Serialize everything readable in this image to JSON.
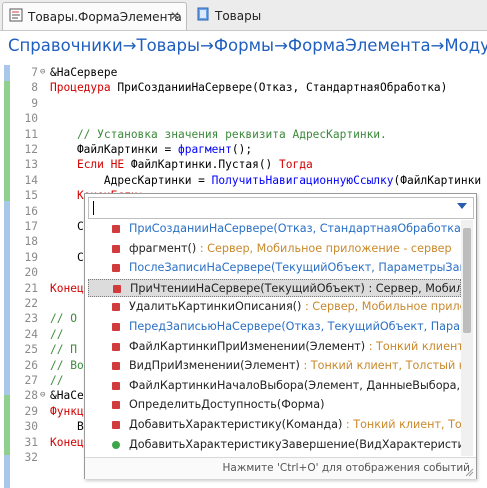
{
  "tabs": [
    {
      "label": "Товары.ФормаЭлемента",
      "close": "✕"
    },
    {
      "label": "Товары"
    }
  ],
  "breadcrumb": "Справочники→Товары→Формы→ФормаЭлемента→Модуль",
  "lines": [
    {
      "num": "7",
      "fold": "⊖",
      "parts": [
        {
          "t": "&НаСервере",
          "c": "pl"
        }
      ]
    },
    {
      "num": "8",
      "parts": [
        {
          "t": "Процедура",
          "c": "kw"
        },
        {
          "t": " ПриСозданииНаСервере(Отказ, СтандартнаяОбработка)",
          "c": "pl"
        }
      ]
    },
    {
      "num": "9",
      "parts": []
    },
    {
      "num": "10",
      "parts": []
    },
    {
      "num": "11",
      "parts": [
        {
          "t": "    // Установка значения реквизита АдресКартинки.",
          "c": "cm"
        }
      ]
    },
    {
      "num": "12",
      "parts": [
        {
          "t": "    ФайлКартинки = ",
          "c": "pl"
        },
        {
          "t": "фрагмент",
          "c": "fn"
        },
        {
          "t": "();",
          "c": "pl"
        }
      ]
    },
    {
      "num": "13",
      "parts": [
        {
          "t": "    ",
          "c": "pl"
        },
        {
          "t": "Если НЕ",
          "c": "kw"
        },
        {
          "t": " ФайлКартинки.Пустая() ",
          "c": "pl"
        },
        {
          "t": "Тогда",
          "c": "kw"
        }
      ]
    },
    {
      "num": "14",
      "parts": [
        {
          "t": "        АдресКартинки = ",
          "c": "pl"
        },
        {
          "t": "ПолучитьНавигационнуюСсылку",
          "c": "fn"
        },
        {
          "t": "(ФайлКартинки",
          "c": "pl"
        }
      ]
    },
    {
      "num": "15",
      "parts": [
        {
          "t": "    КонецЕсли;",
          "c": "kw"
        }
      ]
    },
    {
      "num": "16",
      "parts": []
    },
    {
      "num": "17",
      "parts": [
        {
          "t": "    С",
          "c": "pl"
        }
      ]
    },
    {
      "num": "18",
      "parts": []
    },
    {
      "num": "19",
      "parts": [
        {
          "t": "    С",
          "c": "pl"
        }
      ]
    },
    {
      "num": "20",
      "parts": []
    },
    {
      "num": "21",
      "parts": [
        {
          "t": "КонецП",
          "c": "kw"
        }
      ]
    },
    {
      "num": "22",
      "parts": []
    },
    {
      "num": "23",
      "parts": [
        {
          "t": "// О",
          "c": "cm"
        }
      ]
    },
    {
      "num": "24",
      "parts": [
        {
          "t": "//",
          "c": "cm"
        }
      ]
    },
    {
      "num": "25",
      "parts": [
        {
          "t": "// П",
          "c": "cm"
        }
      ]
    },
    {
      "num": "26",
      "parts": [
        {
          "t": "// Во",
          "c": "cm"
        }
      ]
    },
    {
      "num": "27",
      "parts": [
        {
          "t": "//",
          "c": "cm"
        }
      ]
    },
    {
      "num": "28",
      "fold": "⊖",
      "parts": [
        {
          "t": "&НаСе",
          "c": "pl"
        }
      ]
    },
    {
      "num": "29",
      "parts": [
        {
          "t": "Функц",
          "c": "kw"
        }
      ]
    },
    {
      "num": "30",
      "parts": [
        {
          "t": "    В",
          "c": "pl"
        }
      ]
    },
    {
      "num": "31",
      "parts": [
        {
          "t": "Конец",
          "c": "kw"
        }
      ]
    },
    {
      "num": "32",
      "parts": []
    }
  ],
  "popup": {
    "search_value": "",
    "items": [
      {
        "name": "ПриСозданииНаСервере(Отказ, СтандартнаяОбработка)",
        "ctx": " : Сервер",
        "blue": true
      },
      {
        "name": "фрагмент()",
        "ctx": " : Сервер, Мобильное приложение - сервер",
        "blue": false
      },
      {
        "name": "ПослеЗаписиНаСервере(ТекущийОбъект, ПараметрыЗаписи)",
        "ctx": " : Сервер",
        "blue": true
      },
      {
        "name": "ПриЧтенииНаСервере(ТекущийОбъект)",
        "ctx": " : Сервер, Мобильное приложение - сервер",
        "blue": false,
        "selected": true,
        "ctxColor": "#222"
      },
      {
        "name": "УдалитьКартинкиОписания()",
        "ctx": " : Сервер, Мобильное приложение - сервер",
        "blue": false
      },
      {
        "name": "ПередЗаписьюНаСервере(Отказ, ТекущийОбъект, ПараметрыЗаписи)",
        "ctx": "",
        "blue": true
      },
      {
        "name": "ФайлКартинкиПриИзменении(Элемент)",
        "ctx": " : Тонкий клиент, Толстый клиент",
        "blue": false
      },
      {
        "name": "ВидПриИзменении(Элемент)",
        "ctx": " : Тонкий клиент, Толстый клиент",
        "blue": false
      },
      {
        "name": "ФайлКартинкиНачалоВыбора(Элемент, ДанныеВыбора, СтандартнаяОбработка)",
        "ctx": "",
        "blue": false
      },
      {
        "name": "ОпределитьДоступность(Форма)",
        "ctx": "",
        "blue": false
      },
      {
        "name": "ДобавитьХарактеристику(Команда)",
        "ctx": " : Тонкий клиент, Толстый клиент",
        "blue": false
      },
      {
        "name": "ДобавитьХарактеристикуЗавершение(ВидХарактеристики, ДополнительныеПараметры)",
        "ctx": "",
        "blue": false,
        "icon": "green"
      }
    ],
    "hint": "Нажмите 'Ctrl+O' для отображения событий"
  },
  "colors": {
    "accent": "#1f5fbf",
    "keyword": "#d40000",
    "comment": "#3c8a3c",
    "function": "#0000ff"
  }
}
